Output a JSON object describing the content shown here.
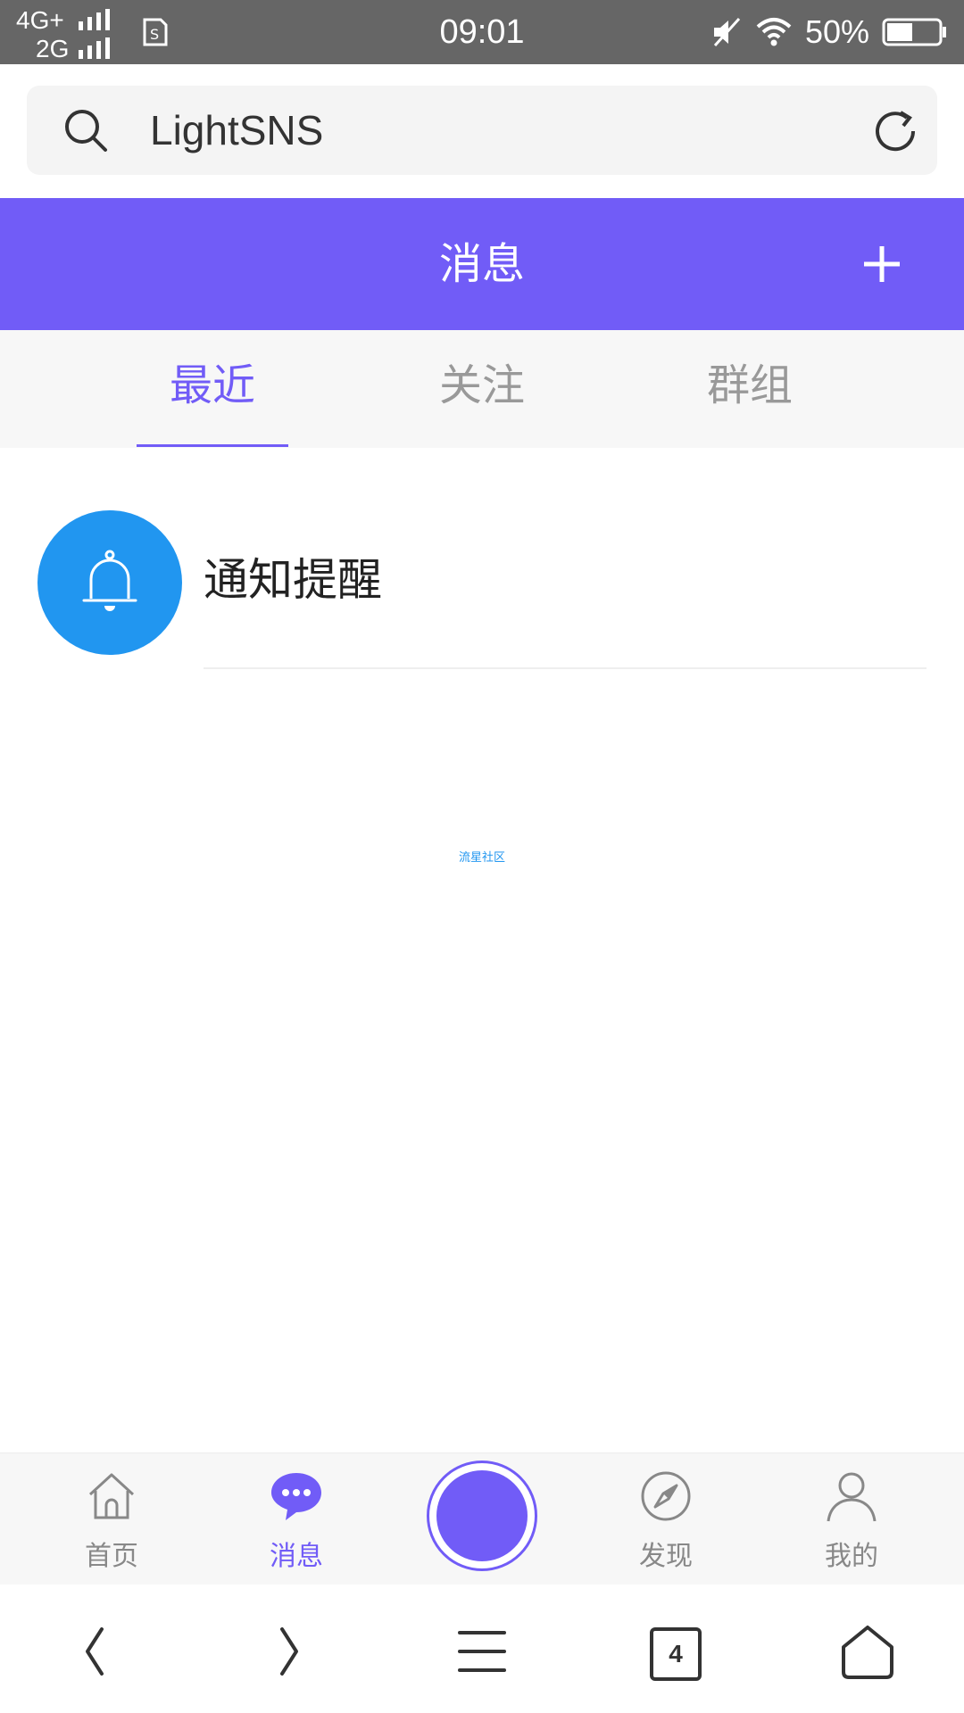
{
  "status_bar": {
    "network_1": "4G+",
    "network_2": "2G",
    "time": "09:01",
    "battery_percent": "50%",
    "icons": [
      "signal-icon",
      "sim-icon",
      "mute-icon",
      "wifi-icon",
      "battery-icon"
    ]
  },
  "search": {
    "value": "LightSNS",
    "icons": [
      "search-icon",
      "refresh-icon"
    ]
  },
  "header": {
    "title": "消息",
    "icon": "plus-icon"
  },
  "tabs": [
    {
      "label": "最近",
      "active": true
    },
    {
      "label": "关注",
      "active": false
    },
    {
      "label": "群组",
      "active": false
    }
  ],
  "list": [
    {
      "title": "通知提醒",
      "icon": "bell-icon",
      "avatar_color": "#2196f0"
    }
  ],
  "footer_text": "流星社区",
  "bottom_nav": [
    {
      "label": "首页",
      "icon": "home-icon",
      "active": false
    },
    {
      "label": "消息",
      "icon": "chat-bubble-icon",
      "active": true
    },
    {
      "label": "",
      "icon": "publish-circle-button",
      "active": false
    },
    {
      "label": "发现",
      "icon": "compass-icon",
      "active": false
    },
    {
      "label": "我的",
      "icon": "user-icon",
      "active": false
    }
  ],
  "browser_bar": {
    "tab_count": "4",
    "icons": [
      "back-icon",
      "forward-icon",
      "menu-icon",
      "tabs-icon",
      "home-outline-icon"
    ]
  },
  "colors": {
    "accent": "#715cf7",
    "bell_avatar": "#2196f0",
    "status_bar": "#666666"
  }
}
